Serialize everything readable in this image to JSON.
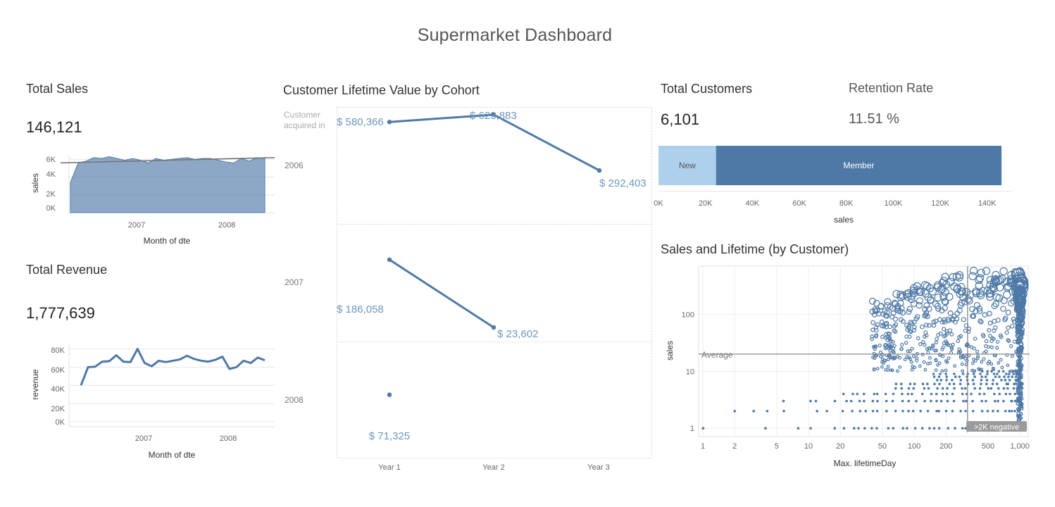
{
  "dashboard": {
    "title": "Supermarket Dashboard"
  },
  "total_sales": {
    "title": "Total Sales",
    "value": "146,121",
    "chart": {
      "x_ticks": [
        "2007",
        "2008"
      ],
      "y_ticks": [
        "6K",
        "4K",
        "2K",
        "0K"
      ],
      "x_title": "Month of dte",
      "y_title": "sales"
    }
  },
  "total_revenue": {
    "title": "Total Revenue",
    "value": "1,777,639",
    "chart": {
      "x_ticks": [
        "2007",
        "2008"
      ],
      "y_ticks": [
        "80K",
        "60K",
        "40K",
        "20K",
        "0K"
      ],
      "x_title": "Month of dte",
      "y_title": "revenue"
    }
  },
  "clv": {
    "title": "Customer Lifetime Value by Cohort",
    "row_header": "Customer acquired in",
    "cohorts": [
      "2006",
      "2007",
      "2008"
    ],
    "x_labels": [
      "Year 1",
      "Year 2",
      "Year 3"
    ],
    "labels": {
      "c2006_y1": "$ 580,366",
      "c2006_y2": "$ 623,883",
      "c2006_y3": "$ 292,403",
      "c2007_y1": "$ 186,058",
      "c2007_y2": "$ 23,602",
      "c2008_y1": "$ 71,325"
    }
  },
  "total_customers": {
    "title": "Total Customers",
    "value": "6,101"
  },
  "retention": {
    "title": "Retention Rate",
    "value": "11.51 %"
  },
  "segment_bar": {
    "new_label": "New",
    "member_label": "Member",
    "x_ticks": [
      "0K",
      "20K",
      "40K",
      "60K",
      "80K",
      "100K",
      "120K",
      "140K"
    ],
    "x_title": "sales"
  },
  "scatter": {
    "title": "Sales and Lifetime (by Customer)",
    "x_ticks": [
      "1",
      "2",
      "5",
      "10",
      "20",
      "50",
      "100",
      "200",
      "500",
      "1,000"
    ],
    "y_ticks": [
      "100",
      "10",
      "1"
    ],
    "x_title": "Max. lifetimeDay",
    "y_title": "sales",
    "average_label": "Average",
    "badge": ">2K negative"
  },
  "colors": {
    "primary": "#4e79a7",
    "light": "#aed0ec",
    "label": "#6d97c2",
    "grid": "#e6e6e6"
  },
  "chart_data": [
    {
      "type": "area",
      "title": "Total Sales",
      "xlabel": "Month of dte",
      "ylabel": "sales",
      "x": [
        "2006-03",
        "2006-04",
        "2006-05",
        "2006-06",
        "2006-07",
        "2006-08",
        "2006-09",
        "2006-10",
        "2006-11",
        "2006-12",
        "2007-01",
        "2007-02",
        "2007-03",
        "2007-04",
        "2007-05",
        "2007-06",
        "2007-07",
        "2007-08",
        "2007-09",
        "2007-10",
        "2007-11",
        "2007-12",
        "2008-01",
        "2008-02",
        "2008-03",
        "2008-04",
        "2008-05",
        "2008-06"
      ],
      "values": [
        3400,
        5600,
        5800,
        6200,
        6100,
        6300,
        6100,
        5900,
        6100,
        5900,
        5600,
        6100,
        5900,
        6000,
        6100,
        6200,
        6000,
        6100,
        6100,
        5900,
        5700,
        5600,
        6100,
        5800,
        6200,
        6100
      ],
      "trend": [
        5600,
        6200
      ],
      "ylim": [
        0,
        6500
      ]
    },
    {
      "type": "line",
      "title": "Total Revenue",
      "xlabel": "Month of dte",
      "ylabel": "revenue",
      "values": [
        40000,
        60000,
        60500,
        66000,
        66500,
        73000,
        66000,
        65500,
        80000,
        64500,
        61000,
        67000,
        65500,
        67000,
        68500,
        72500,
        69000,
        67000,
        66000,
        68000,
        71500,
        58000,
        60000,
        67000,
        64500,
        70500,
        67500
      ],
      "ylim": [
        0,
        85000
      ]
    },
    {
      "type": "line",
      "title": "Customer Lifetime Value by Cohort",
      "categories": [
        "Year 1",
        "Year 2",
        "Year 3"
      ],
      "series": [
        {
          "name": "2006",
          "values": [
            580366,
            623883,
            292403
          ]
        },
        {
          "name": "2007",
          "values": [
            186058,
            23602
          ]
        },
        {
          "name": "2008",
          "values": [
            71325
          ]
        }
      ]
    },
    {
      "type": "bar",
      "orientation": "horizontal",
      "categories": [
        "New",
        "Member"
      ],
      "values": [
        24500,
        121621
      ],
      "xlabel": "sales",
      "xlim": [
        0,
        150000
      ]
    },
    {
      "type": "scatter",
      "title": "Sales and Lifetime (by Customer)",
      "xlabel": "Max. lifetimeDay",
      "ylabel": "sales",
      "x_scale": "log",
      "y_scale": "log",
      "xlim": [
        1,
        1200
      ],
      "ylim": [
        0.8,
        700
      ],
      "average_sales": 20,
      "reference_x": 320
    }
  ]
}
